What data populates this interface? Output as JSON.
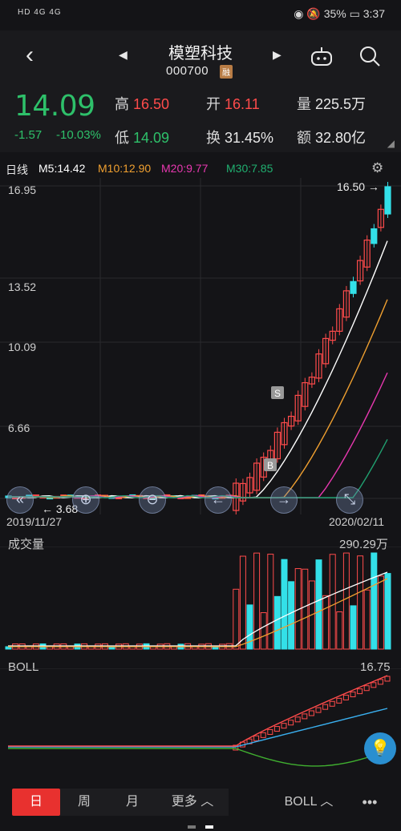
{
  "status": {
    "left": "HD 4G 4G",
    "battery": "35%",
    "time": "3:37"
  },
  "header": {
    "name": "模塑科技",
    "code": "000700",
    "badge": "融"
  },
  "quote": {
    "price": "14.09",
    "change": "-1.57",
    "change_pct": "-10.03%",
    "high_label": "高",
    "high": "16.50",
    "open_label": "开",
    "open": "16.11",
    "volume_label": "量",
    "volume": "225.5万",
    "low_label": "低",
    "low": "14.09",
    "turnover_label": "换",
    "turnover": "31.45%",
    "amount_label": "额",
    "amount": "32.80亿"
  },
  "ma": {
    "period": "日线",
    "m5": "M5:14.42",
    "m10": "M10:12.90",
    "m20": "M20:9.77",
    "m30": "M30:7.85"
  },
  "colors": {
    "up": "#ff4b4b",
    "down": "#33e0e8",
    "ma5": "#ffffff",
    "ma10": "#f0a030",
    "ma20": "#e838b0",
    "ma30": "#20a070"
  },
  "main_chart": {
    "y_ticks": [
      "16.95",
      "13.52",
      "10.09",
      "6.66"
    ],
    "max_label": "16.50",
    "min_label": "3.68",
    "date_start": "2019/11/27",
    "date_end": "2020/02/11",
    "markers": [
      "S",
      "B"
    ]
  },
  "volume": {
    "title": "成交量",
    "max": "290.29万"
  },
  "boll": {
    "title": "BOLL",
    "value": "16.75"
  },
  "bottom_tabs": {
    "day": "日",
    "week": "周",
    "month": "月",
    "more": "更多",
    "indicator": "BOLL",
    "more_dots": "•••"
  }
}
